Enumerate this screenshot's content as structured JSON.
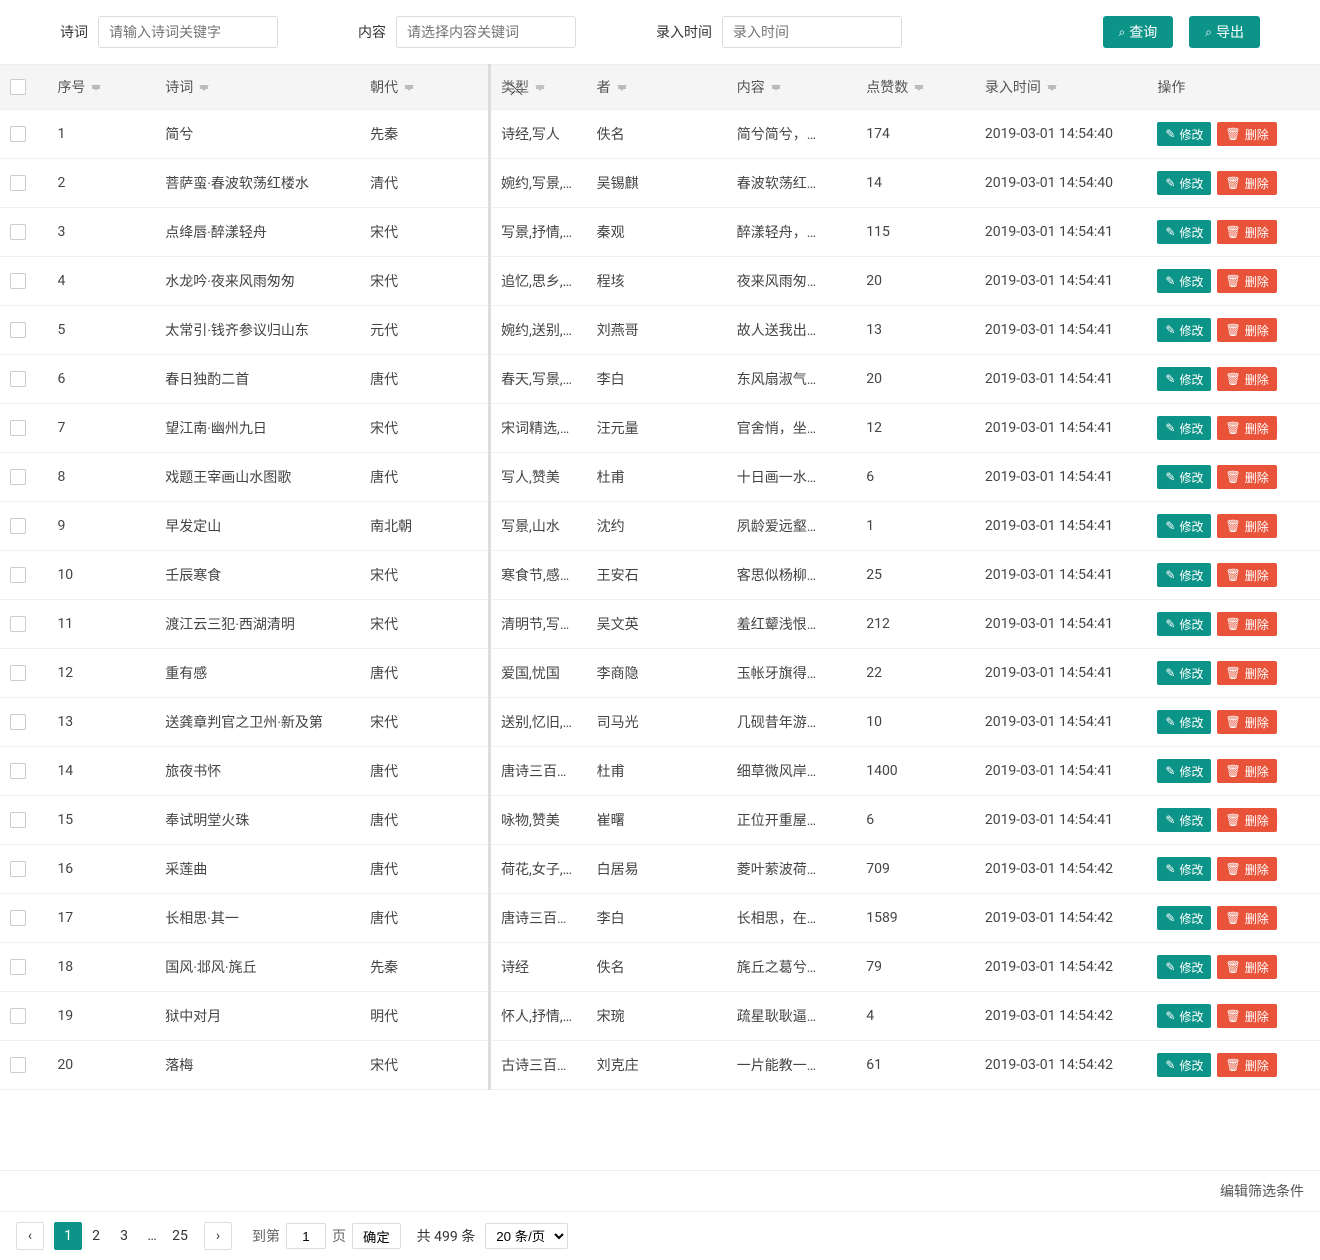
{
  "search": {
    "poem_label": "诗词",
    "poem_placeholder": "请输入诗词关键字",
    "content_label": "内容",
    "content_placeholder": "请选择内容关键词",
    "date_label": "录入时间",
    "date_placeholder": "录入时间",
    "query_btn": "查询",
    "export_btn": "导出"
  },
  "columns": {
    "seq": "序号",
    "poem": "诗词",
    "dynasty": "朝代",
    "type": "类型",
    "author": "者",
    "content": "内容",
    "likes": "点赞数",
    "time": "录入时间",
    "op": "操作"
  },
  "rows": [
    {
      "seq": "1",
      "poem": "简兮",
      "dynasty": "先秦",
      "type": "诗经,写人",
      "author": "佚名",
      "content": "简兮简兮，…",
      "likes": "174",
      "time": "2019-03-01 14:54:40"
    },
    {
      "seq": "2",
      "poem": "菩萨蛮·春波软荡红楼水",
      "dynasty": "清代",
      "type": "婉约,写景,…",
      "author": "吴锡麒",
      "content": "春波软荡红…",
      "likes": "14",
      "time": "2019-03-01 14:54:40"
    },
    {
      "seq": "3",
      "poem": "点绛唇·醉漾轻舟",
      "dynasty": "宋代",
      "type": "写景,抒情,…",
      "author": "秦观",
      "content": "醉漾轻舟，…",
      "likes": "115",
      "time": "2019-03-01 14:54:41"
    },
    {
      "seq": "4",
      "poem": "水龙吟·夜来风雨匆匆",
      "dynasty": "宋代",
      "type": "追忆,思乡,…",
      "author": "程垓",
      "content": "夜来风雨匆…",
      "likes": "20",
      "time": "2019-03-01 14:54:41"
    },
    {
      "seq": "5",
      "poem": "太常引·钱齐参议归山东",
      "dynasty": "元代",
      "type": "婉约,送别,…",
      "author": "刘燕哥",
      "content": "故人送我出…",
      "likes": "13",
      "time": "2019-03-01 14:54:41"
    },
    {
      "seq": "6",
      "poem": "春日独酌二首",
      "dynasty": "唐代",
      "type": "春天,写景,…",
      "author": "李白",
      "content": "东风扇淑气…",
      "likes": "20",
      "time": "2019-03-01 14:54:41"
    },
    {
      "seq": "7",
      "poem": "望江南·幽州九日",
      "dynasty": "宋代",
      "type": "宋词精选,…",
      "author": "汪元量",
      "content": "官舍悄，坐…",
      "likes": "12",
      "time": "2019-03-01 14:54:41"
    },
    {
      "seq": "8",
      "poem": "戏题王宰画山水图歌",
      "dynasty": "唐代",
      "type": "写人,赞美",
      "author": "杜甫",
      "content": "十日画一水…",
      "likes": "6",
      "time": "2019-03-01 14:54:41"
    },
    {
      "seq": "9",
      "poem": "早发定山",
      "dynasty": "南北朝",
      "type": "写景,山水",
      "author": "沈约",
      "content": "夙龄爱远壑…",
      "likes": "1",
      "time": "2019-03-01 14:54:41"
    },
    {
      "seq": "10",
      "poem": "壬辰寒食",
      "dynasty": "宋代",
      "type": "寒食节,感…",
      "author": "王安石",
      "content": "客思似杨柳…",
      "likes": "25",
      "time": "2019-03-01 14:54:41"
    },
    {
      "seq": "11",
      "poem": "渡江云三犯·西湖清明",
      "dynasty": "宋代",
      "type": "清明节,写…",
      "author": "吴文英",
      "content": "羞红颦浅恨…",
      "likes": "212",
      "time": "2019-03-01 14:54:41"
    },
    {
      "seq": "12",
      "poem": "重有感",
      "dynasty": "唐代",
      "type": "爱国,忧国",
      "author": "李商隐",
      "content": "玉帐牙旗得…",
      "likes": "22",
      "time": "2019-03-01 14:54:41"
    },
    {
      "seq": "13",
      "poem": "送龚章判官之卫州·新及第",
      "dynasty": "宋代",
      "type": "送别,忆旧,…",
      "author": "司马光",
      "content": "几砚昔年游…",
      "likes": "10",
      "time": "2019-03-01 14:54:41"
    },
    {
      "seq": "14",
      "poem": "旅夜书怀",
      "dynasty": "唐代",
      "type": "唐诗三百…",
      "author": "杜甫",
      "content": "细草微风岸…",
      "likes": "1400",
      "time": "2019-03-01 14:54:41"
    },
    {
      "seq": "15",
      "poem": "奉试明堂火珠",
      "dynasty": "唐代",
      "type": "咏物,赞美",
      "author": "崔曙",
      "content": "正位开重屋…",
      "likes": "6",
      "time": "2019-03-01 14:54:41"
    },
    {
      "seq": "16",
      "poem": "采莲曲",
      "dynasty": "唐代",
      "type": "荷花,女子,…",
      "author": "白居易",
      "content": "菱叶萦波荷…",
      "likes": "709",
      "time": "2019-03-01 14:54:42"
    },
    {
      "seq": "17",
      "poem": "长相思·其一",
      "dynasty": "唐代",
      "type": "唐诗三百…",
      "author": "李白",
      "content": "长相思，在…",
      "likes": "1589",
      "time": "2019-03-01 14:54:42"
    },
    {
      "seq": "18",
      "poem": "国风·邶风·旄丘",
      "dynasty": "先秦",
      "type": "诗经",
      "author": "佚名",
      "content": "旄丘之葛兮…",
      "likes": "79",
      "time": "2019-03-01 14:54:42"
    },
    {
      "seq": "19",
      "poem": "狱中对月",
      "dynasty": "明代",
      "type": "怀人,抒情,…",
      "author": "宋琬",
      "content": "疏星耿耿逼…",
      "likes": "4",
      "time": "2019-03-01 14:54:42"
    },
    {
      "seq": "20",
      "poem": "落梅",
      "dynasty": "宋代",
      "type": "古诗三百…",
      "author": "刘克庄",
      "content": "一片能教一…",
      "likes": "61",
      "time": "2019-03-01 14:54:42"
    }
  ],
  "actions": {
    "edit": "修改",
    "delete": "删除"
  },
  "footer": {
    "edit_filter": "编辑筛选条件",
    "prev": "‹",
    "next": "›",
    "pages": [
      "1",
      "2",
      "3",
      "…",
      "25"
    ],
    "active_page": "1",
    "goto_label": "到第",
    "goto_value": "1",
    "goto_suffix": "页",
    "confirm": "确定",
    "total": "共 499 条",
    "per_page": "20 条/页"
  }
}
